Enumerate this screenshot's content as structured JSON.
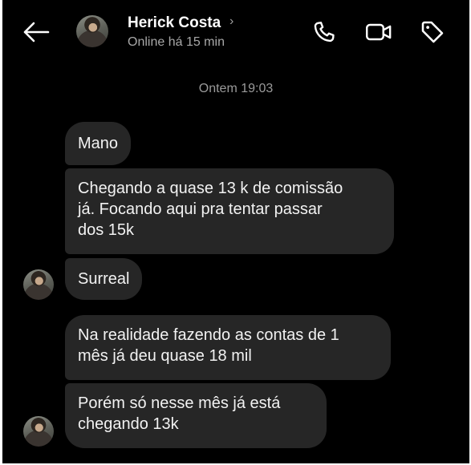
{
  "header": {
    "contact_name": "Herick Costa",
    "chevron": "›",
    "status": "Online há 15 min",
    "icons": [
      "back-arrow-icon",
      "phone-icon",
      "video-camera-icon",
      "tag-icon"
    ]
  },
  "conversation": {
    "timestamp": "Ontem 19:03",
    "messages": [
      {
        "text": "Mano"
      },
      {
        "text": "Chegando a quase 13 k de comissão\njá. Focando aqui pra tentar passar\ndos 15k"
      },
      {
        "text": "Surreal"
      },
      {
        "text": "Na realidade fazendo as contas de 1\nmês já deu quase 18 mil"
      },
      {
        "text": "Porém só nesse mês já está\nchegando 13k"
      }
    ]
  },
  "colors": {
    "background": "#000000",
    "bubble": "#262626",
    "text": "#f2f2f2",
    "muted": "#a8a8a8"
  }
}
